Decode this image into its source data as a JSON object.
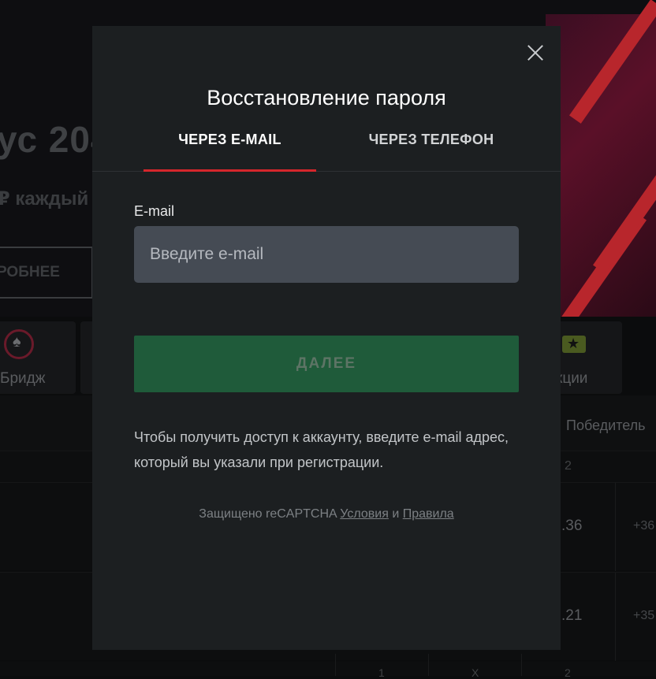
{
  "background": {
    "banner": {
      "title": "ус 204",
      "subtitle": "₽ каждый",
      "button_label": "РОБНЕЕ"
    },
    "categories": [
      {
        "label": "Бридж",
        "icon": "spade-icon"
      },
      {
        "label": "кции",
        "icon": "star-icon"
      }
    ],
    "table": {
      "header_winner": "Победитель",
      "subheader_col": "2",
      "rows": [
        {
          "odd": ".36",
          "more": "+36"
        },
        {
          "odd": ".21",
          "more": "+35"
        }
      ],
      "footer_cols": [
        "1",
        "X",
        "2"
      ]
    }
  },
  "modal": {
    "title": "Восстановление пароля",
    "tabs": [
      {
        "label": "ЧЕРЕЗ E-MAIL",
        "active": true
      },
      {
        "label": "ЧЕРЕЗ ТЕЛЕФОН",
        "active": false
      }
    ],
    "email_label": "E-mail",
    "email_placeholder": "Введите e-mail",
    "email_value": "",
    "next_button": "ДАЛЕЕ",
    "hint": "Чтобы получить доступ к аккаунту, введите e-mail адрес, который вы указали при регистрации.",
    "captcha": {
      "prefix": "Защищено reCAPTCHA",
      "terms": "Условия",
      "and": "и",
      "rules": "Правила"
    }
  },
  "colors": {
    "accent_red": "#d5262c",
    "button_green": "#1f5b3a",
    "modal_bg": "#1c1f21",
    "input_bg": "#454b54"
  }
}
